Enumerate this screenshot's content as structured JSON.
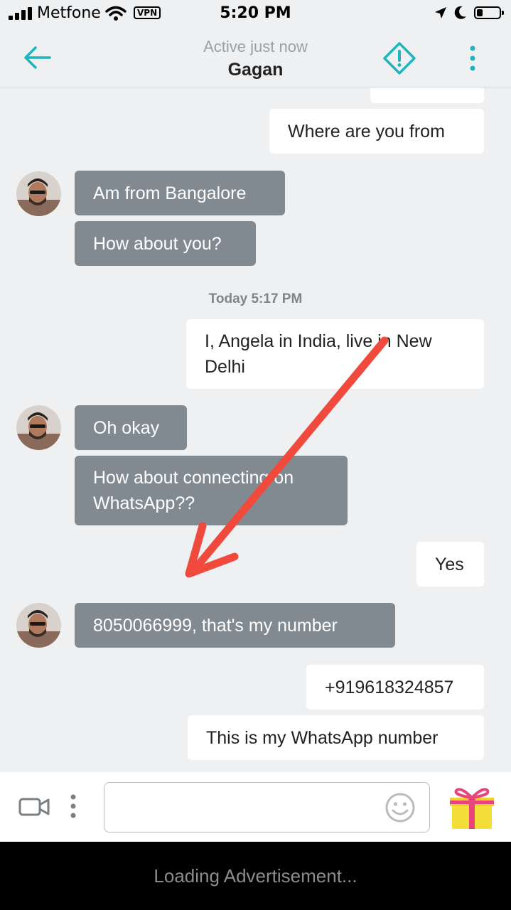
{
  "status_bar": {
    "carrier": "Metfone",
    "vpn": "VPN",
    "time": "5:20 PM"
  },
  "header": {
    "subtitle": "Active just now",
    "title": "Gagan"
  },
  "messages": {
    "m0": "",
    "m1": "Where are you from",
    "m2": "Am from Bangalore",
    "m3": "How about you?",
    "timestamp": "Today 5:17 PM",
    "m4": "I, Angela in India, live in New Delhi",
    "m5": "Oh okay",
    "m6": "How about connecting on WhatsApp??",
    "m7": "Yes",
    "m8": "8050066999, that's my number",
    "m9": "+919618324857",
    "m10": "This is my WhatsApp number"
  },
  "composer": {
    "placeholder": "",
    "value": ""
  },
  "ad": {
    "text": "Loading Advertisement..."
  },
  "colors": {
    "accent": "#1fb5bd",
    "incoming_bubble": "#818a91",
    "outgoing_bubble": "#ffffff",
    "annotation_arrow": "#f04a3c"
  }
}
